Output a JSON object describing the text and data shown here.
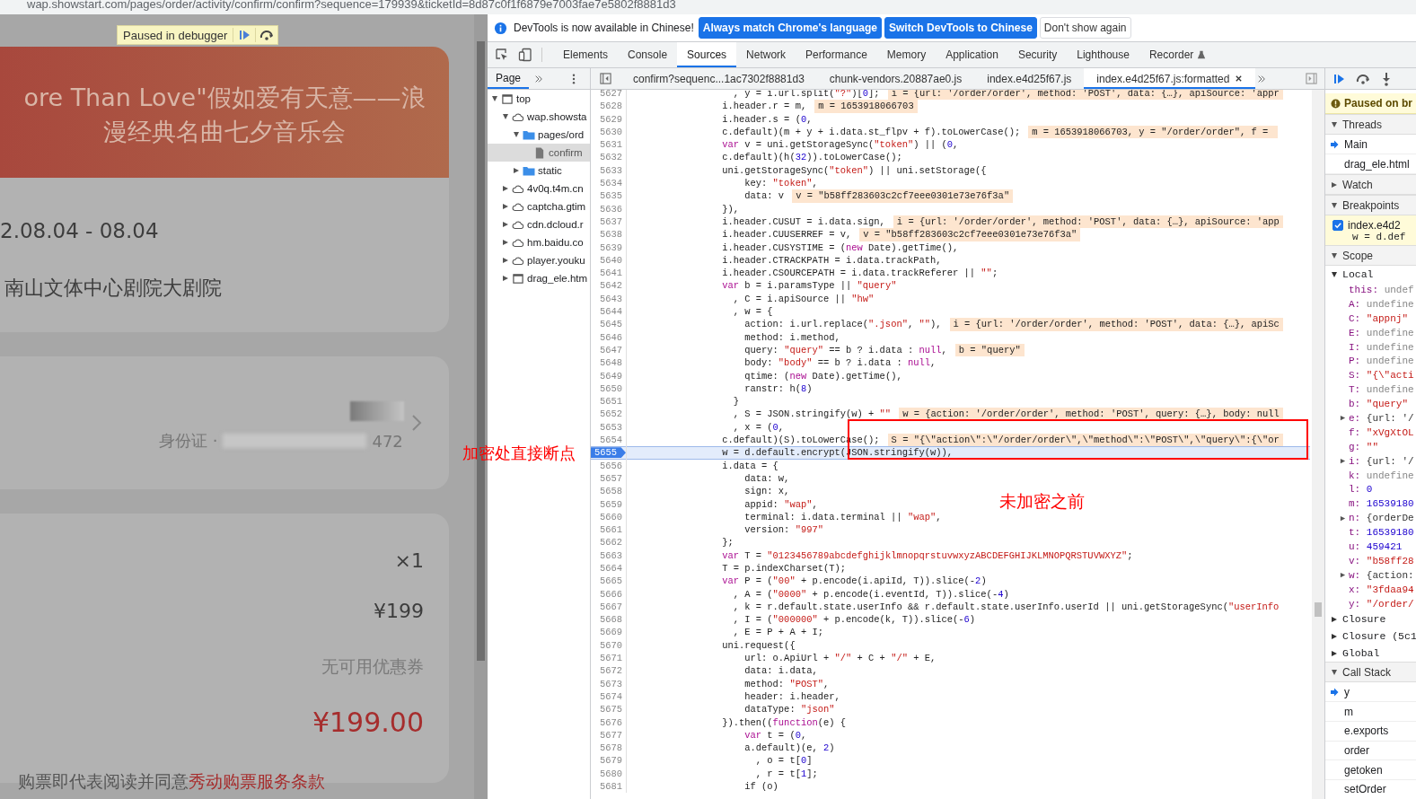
{
  "address_bar": {
    "url": "wap.showstart.com/pages/order/activity/confirm/confirm?sequence=179939&ticketId=8d87c0f1f6879e7003fae7e5802f8881d3"
  },
  "page": {
    "paused_label": "Paused in debugger",
    "event": {
      "title_lines": [
        "ore Than Love\"假如爱有天意——浪",
        "漫经典名曲七夕音乐会"
      ],
      "date": "2.08.04 - 08.04",
      "venue": "南山文体中心剧院大剧院"
    },
    "buyer": {
      "id_label": "身份证 ·",
      "id_tail": "472"
    },
    "order": {
      "quantity": "×1",
      "price": "¥199",
      "coupon": "无可用优惠券",
      "total": "¥199.00"
    },
    "agreement": {
      "text": "购票即代表阅读并同意",
      "link": "秀动购票服务条款"
    }
  },
  "devtools": {
    "infobar": {
      "message": "DevTools is now available in Chinese!",
      "buttons": [
        {
          "label": "Always match Chrome's language",
          "primary": true
        },
        {
          "label": "Switch DevTools to Chinese",
          "primary": true
        },
        {
          "label": "Don't show again",
          "primary": false
        }
      ]
    },
    "tabs": [
      {
        "label": "Elements",
        "selected": false
      },
      {
        "label": "Console",
        "selected": false
      },
      {
        "label": "Sources",
        "selected": true
      },
      {
        "label": "Network",
        "selected": false
      },
      {
        "label": "Performance",
        "selected": false
      },
      {
        "label": "Memory",
        "selected": false
      },
      {
        "label": "Application",
        "selected": false
      },
      {
        "label": "Security",
        "selected": false
      },
      {
        "label": "Lighthouse",
        "selected": false
      },
      {
        "label": "Recorder",
        "selected": false
      }
    ],
    "navigator": {
      "tab": "Page",
      "tree": [
        {
          "label": "top",
          "kind": "frame",
          "expanded": true,
          "selected": false,
          "children": [
            {
              "label": "wap.showsta",
              "kind": "cloud",
              "expanded": true,
              "selected": false,
              "children": [
                {
                  "label": "pages/ord",
                  "kind": "folder",
                  "expanded": true,
                  "selected": false,
                  "children": [
                    {
                      "label": "confirm",
                      "kind": "file",
                      "selected": true
                    }
                  ]
                },
                {
                  "label": "static",
                  "kind": "folder",
                  "expanded": false,
                  "selected": false
                }
              ]
            },
            {
              "label": "4v0q.t4m.cn",
              "kind": "cloud",
              "expanded": false,
              "selected": false
            },
            {
              "label": "captcha.gtim",
              "kind": "cloud",
              "expanded": false,
              "selected": false
            },
            {
              "label": "cdn.dcloud.r",
              "kind": "cloud",
              "expanded": false,
              "selected": false
            },
            {
              "label": "hm.baidu.co",
              "kind": "cloud",
              "expanded": false,
              "selected": false
            },
            {
              "label": "player.youku",
              "kind": "cloud",
              "expanded": false,
              "selected": false
            },
            {
              "label": "drag_ele.htm",
              "kind": "frame",
              "expanded": false,
              "selected": false
            }
          ]
        }
      ]
    },
    "editor_tabs": [
      {
        "label": "confirm?sequenc...1ac7302f8881d3",
        "selected": false
      },
      {
        "label": "chunk-vendors.20887ae0.js",
        "selected": false
      },
      {
        "label": "index.e4d25f67.js",
        "selected": false
      },
      {
        "label": "index.e4d25f67.js:formatted",
        "selected": true
      }
    ],
    "code": [
      {
        "number": "5627",
        "text": "                  , y = i.url.split(\"?\")[0];",
        "hint": "i = {url: '/order/order', method: 'POST', data: {…}, apiSource: 'appr"
      },
      {
        "number": "5628",
        "text": "                i.header.r = m,",
        "hint": "m = 1653918066703"
      },
      {
        "number": "5629",
        "text": "                i.header.s = (0,"
      },
      {
        "number": "5630",
        "text": "                c.default)(m + y + i.data.st_flpv + f).toLowerCase();",
        "hint": "m = 1653918066703, y = \"/order/order\", f = "
      },
      {
        "number": "5631",
        "text": "                var v = uni.getStorageSync(\"token\") || (0,"
      },
      {
        "number": "5632",
        "text": "                c.default)(h(32)).toLowerCase();"
      },
      {
        "number": "5633",
        "text": "                uni.getStorageSync(\"token\") || uni.setStorage({"
      },
      {
        "number": "5634",
        "text": "                    key: \"token\","
      },
      {
        "number": "5635",
        "text": "                    data: v",
        "hint": "v = \"b58ff283603c2cf7eee0301e73e76f3a\""
      },
      {
        "number": "5636",
        "text": "                }),"
      },
      {
        "number": "5637",
        "text": "                i.header.CUSUT = i.data.sign,",
        "hint": "i = {url: '/order/order', method: 'POST', data: {…}, apiSource: 'app"
      },
      {
        "number": "5638",
        "text": "                i.header.CUUSERREF = v,",
        "hint": "v = \"b58ff283603c2cf7eee0301e73e76f3a\""
      },
      {
        "number": "5639",
        "text": "                i.header.CUSYSTIME = (new Date).getTime(),"
      },
      {
        "number": "5640",
        "text": "                i.header.CTRACKPATH = i.data.trackPath,"
      },
      {
        "number": "5641",
        "text": "                i.header.CSOURCEPATH = i.data.trackReferer || \"\";"
      },
      {
        "number": "5642",
        "text": "                var b = i.paramsType || \"query\""
      },
      {
        "number": "5643",
        "text": "                  , C = i.apiSource || \"hw\""
      },
      {
        "number": "5644",
        "text": "                  , w = {"
      },
      {
        "number": "5645",
        "text": "                    action: i.url.replace(\".json\", \"\"),",
        "hint": "i = {url: '/order/order', method: 'POST', data: {…}, apiSc"
      },
      {
        "number": "5646",
        "text": "                    method: i.method,"
      },
      {
        "number": "5647",
        "text": "                    query: \"query\" == b ? i.data : null,",
        "hint": "b = \"query\""
      },
      {
        "number": "5648",
        "text": "                    body: \"body\" == b ? i.data : null,"
      },
      {
        "number": "5649",
        "text": "                    qtime: (new Date).getTime(),"
      },
      {
        "number": "5650",
        "text": "                    ranstr: h(8)"
      },
      {
        "number": "5651",
        "text": "                  }"
      },
      {
        "number": "5652",
        "text": "                  , S = JSON.stringify(w) + \"\"",
        "hint": "w = {action: '/order/order', method: 'POST', query: {…}, body: null"
      },
      {
        "number": "5653",
        "text": "                  , x = (0,"
      },
      {
        "number": "5654",
        "text": "                c.default)(S).toLowerCase();",
        "hint": "S = \"{\\\"action\\\":\\\"/order/order\\\",\\\"method\\\":\\\"POST\\\",\\\"query\\\":{\\\"or"
      },
      {
        "number": "5655",
        "text": "                w = d.default.encrypt(JSON.stringify(w)),",
        "paused": true
      },
      {
        "number": "5656",
        "text": "                i.data = {"
      },
      {
        "number": "5657",
        "text": "                    data: w,"
      },
      {
        "number": "5658",
        "text": "                    sign: x,"
      },
      {
        "number": "5659",
        "text": "                    appid: \"wap\","
      },
      {
        "number": "5660",
        "text": "                    terminal: i.data.terminal || \"wap\","
      },
      {
        "number": "5661",
        "text": "                    version: \"997\""
      },
      {
        "number": "5662",
        "text": "                };"
      },
      {
        "number": "5663",
        "text": "                var T = \"0123456789abcdefghijklmnopqrstuvwxyzABCDEFGHIJKLMNOPQRSTUVWXYZ\";"
      },
      {
        "number": "5664",
        "text": "                T = p.indexCharset(T);"
      },
      {
        "number": "5665",
        "text": "                var P = (\"00\" + p.encode(i.apiId, T)).slice(-2)"
      },
      {
        "number": "5666",
        "text": "                  , A = (\"0000\" + p.encode(i.eventId, T)).slice(-4)"
      },
      {
        "number": "5667",
        "text": "                  , k = r.default.state.userInfo && r.default.state.userInfo.userId || uni.getStorageSync(\"userInfo"
      },
      {
        "number": "5668",
        "text": "                  , I = (\"000000\" + p.encode(k, T)).slice(-6)"
      },
      {
        "number": "5669",
        "text": "                  , E = P + A + I;"
      },
      {
        "number": "5670",
        "text": "                uni.request({"
      },
      {
        "number": "5671",
        "text": "                    url: o.ApiUrl + \"/\" + C + \"/\" + E,"
      },
      {
        "number": "5672",
        "text": "                    data: i.data,"
      },
      {
        "number": "5673",
        "text": "                    method: \"POST\","
      },
      {
        "number": "5674",
        "text": "                    header: i.header,"
      },
      {
        "number": "5675",
        "text": "                    dataType: \"json\""
      },
      {
        "number": "5676",
        "text": "                }).then((function(e) {"
      },
      {
        "number": "5677",
        "text": "                    var t = (0,"
      },
      {
        "number": "5678",
        "text": "                    a.default)(e, 2)"
      },
      {
        "number": "5679",
        "text": "                      , o = t[0]"
      },
      {
        "number": "5680",
        "text": "                      , r = t[1];"
      },
      {
        "number": "5681",
        "text": "                    if (o)"
      }
    ],
    "debugger": {
      "paused_message": "Paused on br",
      "threads": {
        "label": "Threads",
        "expanded": true,
        "items": [
          {
            "name": "Main",
            "selected": true
          },
          {
            "name": "drag_ele.html",
            "selected": false
          }
        ]
      },
      "watch": {
        "label": "Watch",
        "expanded": false
      },
      "breakpoints": {
        "label": "Breakpoints",
        "expanded": true,
        "items": [
          {
            "file": "index.e4d2",
            "code": "w = d.def",
            "checked": true
          }
        ]
      },
      "scope": {
        "label": "Scope",
        "expanded": true,
        "local": {
          "label": "Local",
          "expanded": true,
          "vars": [
            {
              "name": "this:",
              "value": "undef",
              "kind": "undefined",
              "expandable": false
            },
            {
              "name": "A:",
              "value": "undefine",
              "kind": "undefined",
              "expandable": false
            },
            {
              "name": "C:",
              "value": "\"appnj\"",
              "kind": "string",
              "expandable": false
            },
            {
              "name": "E:",
              "value": "undefine",
              "kind": "undefined",
              "expandable": false
            },
            {
              "name": "I:",
              "value": "undefine",
              "kind": "undefined",
              "expandable": false
            },
            {
              "name": "P:",
              "value": "undefine",
              "kind": "undefined",
              "expandable": false
            },
            {
              "name": "S:",
              "value": "\"{\\\"acti",
              "kind": "string",
              "expandable": false
            },
            {
              "name": "T:",
              "value": "undefine",
              "kind": "undefined",
              "expandable": false
            },
            {
              "name": "b:",
              "value": "\"query\"",
              "kind": "string",
              "expandable": false
            },
            {
              "name": "e:",
              "value": "{url: '/",
              "kind": "object",
              "expandable": true
            },
            {
              "name": "f:",
              "value": "\"xVgXtOL",
              "kind": "string",
              "expandable": false
            },
            {
              "name": "g:",
              "value": "\"\"",
              "kind": "string",
              "expandable": false
            },
            {
              "name": "i:",
              "value": "{url: '/",
              "kind": "object",
              "expandable": true
            },
            {
              "name": "k:",
              "value": "undefine",
              "kind": "undefined",
              "expandable": false
            },
            {
              "name": "l:",
              "value": "0",
              "kind": "number",
              "expandable": false
            },
            {
              "name": "m:",
              "value": "16539180",
              "kind": "number",
              "expandable": false
            },
            {
              "name": "n:",
              "value": "{orderDe",
              "kind": "object",
              "expandable": true
            },
            {
              "name": "t:",
              "value": "16539180",
              "kind": "number",
              "expandable": false
            },
            {
              "name": "u:",
              "value": "459421",
              "kind": "number",
              "expandable": false
            },
            {
              "name": "v:",
              "value": "\"b58ff28",
              "kind": "string",
              "expandable": false
            },
            {
              "name": "w:",
              "value": "{action:",
              "kind": "object",
              "expandable": true
            },
            {
              "name": "x:",
              "value": "\"3fdaa94",
              "kind": "string",
              "expandable": false
            },
            {
              "name": "y:",
              "value": "\"/order/",
              "kind": "string",
              "expandable": false
            }
          ]
        },
        "others": [
          {
            "label": "Closure",
            "expanded": false
          },
          {
            "label": "Closure (5c1",
            "expanded": false
          },
          {
            "label": "Global",
            "expanded": false
          }
        ]
      },
      "call_stack": {
        "label": "Call Stack",
        "expanded": true,
        "frames": [
          {
            "name": "y",
            "selected": true
          },
          {
            "name": "m",
            "selected": false
          },
          {
            "name": "e.exports",
            "selected": false
          },
          {
            "name": "order",
            "selected": false
          },
          {
            "name": "getoken",
            "selected": false
          },
          {
            "name": "setOrder",
            "selected": false
          }
        ]
      }
    }
  },
  "annotations": [
    {
      "text": "加密处直接断点"
    },
    {
      "text": "未加密之前"
    }
  ]
}
